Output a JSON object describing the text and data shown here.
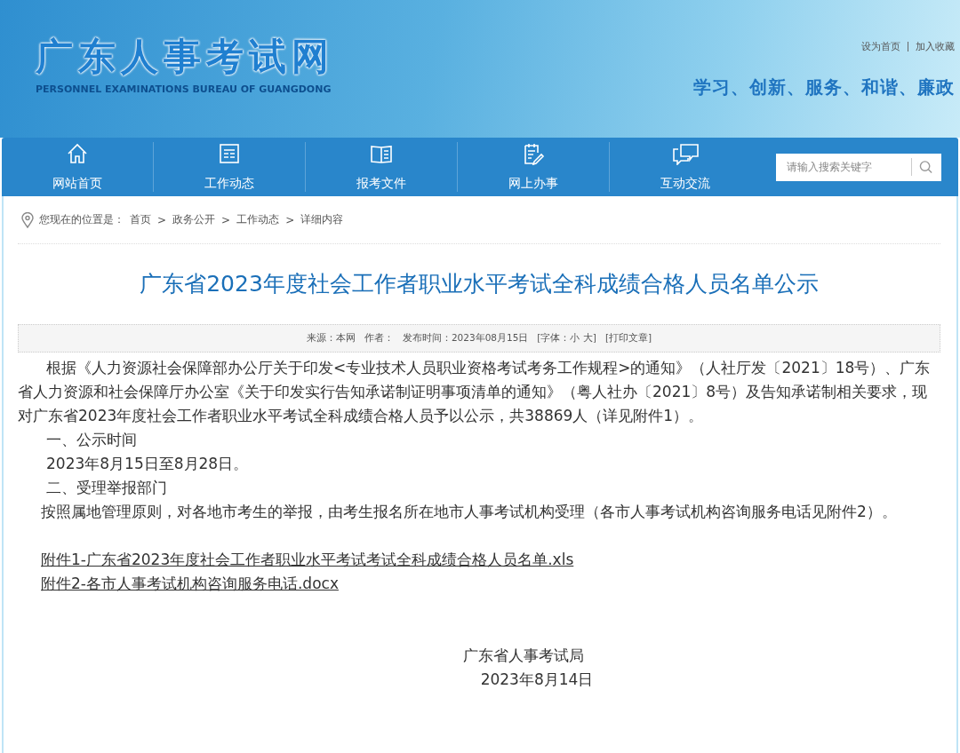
{
  "header": {
    "logo_title": "广东人事考试网",
    "logo_subtitle": "PERSONNEL EXAMINATIONS BUREAU OF GUANGDONG",
    "top_links": [
      "设为首页",
      "加入收藏"
    ],
    "slogan": "学习、创新、服务、和谐、廉政"
  },
  "nav": {
    "items": [
      {
        "label": "网站首页",
        "kind": "home"
      },
      {
        "label": "工作动态",
        "kind": "news"
      },
      {
        "label": "报考文件",
        "kind": "book"
      },
      {
        "label": "网上办事",
        "kind": "form"
      },
      {
        "label": "互动交流",
        "kind": "chat"
      }
    ],
    "search": {
      "placeholder": "请输入搜索关键字"
    }
  },
  "breadcrumb": {
    "label": "您现在的位置是：",
    "items": [
      "首页",
      "政务公开",
      "工作动态",
      "详细内容"
    ],
    "separators": [
      ">",
      ">",
      ">"
    ]
  },
  "article": {
    "title": "广东省2023年度社会工作者职业水平考试全科成绩合格人员名单公示",
    "meta": [
      "来源：本网",
      "作者：",
      "发布时间：2023年08月15日",
      "[字体：小 大]",
      "[打印文章]"
    ],
    "paragraphs": [
      {
        "kind": "indent",
        "text": "根据《人力资源社会保障部办公厅关于印发<专业技术人员职业资格考试考务工作规程>的通知》（人社厅发〔2021〕18号）、广东省人力资源和社会保障厅办公室《关于印发实行告知承诺制证明事项清单的通知》（粤人社办〔2021〕8号）及告知承诺制相关要求，现对广东省2023年度社会工作者职业水平考试全科成绩合格人员予以公示，共38869人（详见附件1）。"
      },
      {
        "kind": "heading",
        "text": "一、公示时间"
      },
      {
        "kind": "heading",
        "text": "2023年8月15日至8月28日。"
      },
      {
        "kind": "heading",
        "text": "二、受理举报部门"
      },
      {
        "kind": "short",
        "text": "按照属地管理原则，对各地市考生的举报，由考生报名所在地市人事考试机构受理（各市人事考试机构咨询服务电话见附件2）。"
      }
    ],
    "attachments": [
      "附件1-广东省2023年度社会工作者职业水平考试考试全科成绩合格人员名单.xls",
      "附件2-各市人事考试机构咨询服务电话.docx"
    ],
    "signature": {
      "org": "广东省人事考试局",
      "date": "2023年8月14日"
    }
  }
}
